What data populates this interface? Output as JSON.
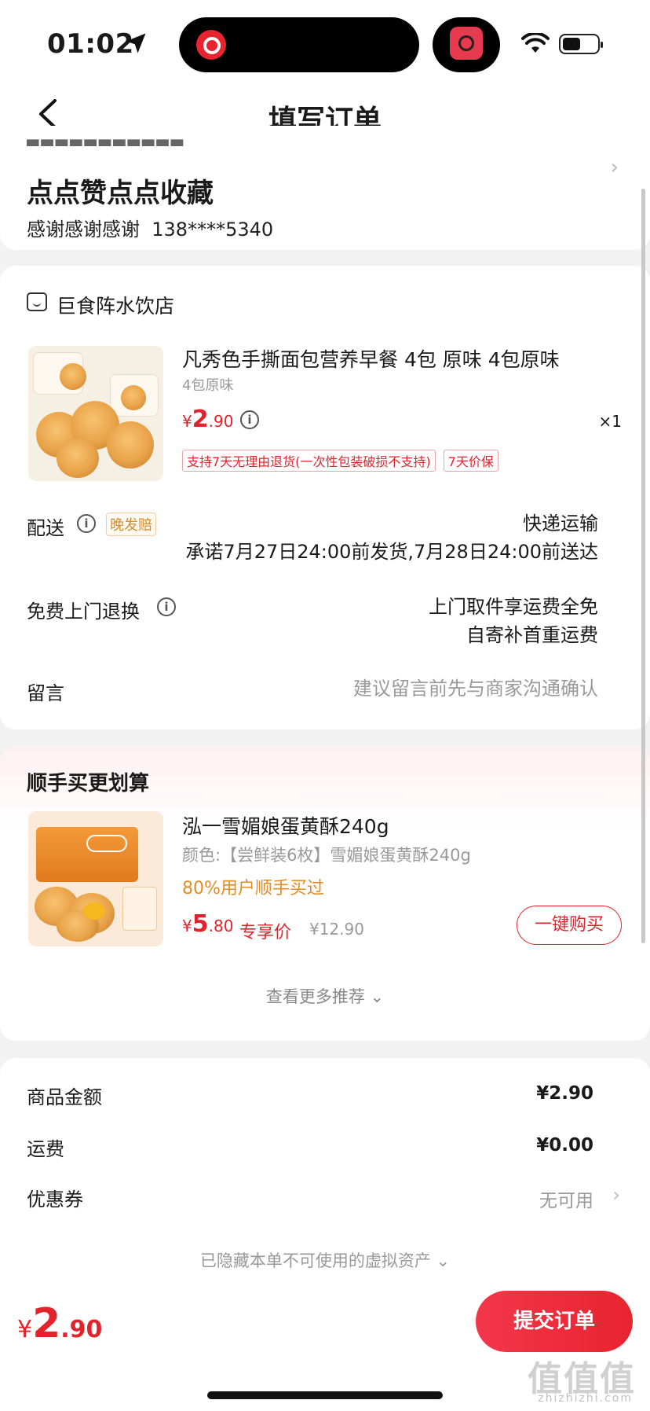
{
  "status_bar": {
    "time": "01:02"
  },
  "nav": {
    "title": "填写订单"
  },
  "address": {
    "name": "点点赞点点收藏",
    "contact_name": "感谢感谢感谢",
    "phone": "138****5340"
  },
  "order": {
    "shop_name": "巨食阵水饮店",
    "product": {
      "title": "凡秀色手撕面包营养早餐 4包 原味 4包原味",
      "spec": "4包原味",
      "price_symbol": "¥",
      "price_int": "2",
      "price_dec": ".90",
      "quantity": "×1",
      "tags": [
        "支持7天无理由退货(一次性包装破损不支持)",
        "7天价保"
      ]
    },
    "delivery": {
      "label": "配送",
      "badge": "晚发赔",
      "method": "快递运输",
      "promise": "承诺7月27日24:00前发货,7月28日24:00前送达"
    },
    "return": {
      "label": "免费上门退换",
      "line1": "上门取件享运费全免",
      "line2": "自寄补首重运费"
    },
    "message": {
      "label": "留言",
      "placeholder": "建议留言前先与商家沟通确认"
    }
  },
  "recommend": {
    "title": "顺手买更划算",
    "item": {
      "title": "泓一雪媚娘蛋黄酥240g",
      "spec": "颜色:【尝鲜装6枚】雪媚娘蛋黄酥240g",
      "hint": "80%用户顺手买过",
      "price_symbol": "¥",
      "price_int": "5",
      "price_dec": ".80",
      "exclusive": "专享价",
      "original_price": "¥12.90",
      "buy_label": "一键购买"
    },
    "more_label": "查看更多推荐 ⌄"
  },
  "summary": {
    "goods_label": "商品金额",
    "goods_value": "¥2.90",
    "shipping_label": "运费",
    "shipping_value": "¥0.00",
    "coupon_label": "优惠券",
    "coupon_value": "无可用",
    "hidden_assets": "已隐藏本单不可使用的虚拟资产 ⌄"
  },
  "bottom": {
    "total_symbol": "¥",
    "total_int": "2",
    "total_dec": ".90",
    "submit_label": "提交订单"
  },
  "watermark": {
    "main": "值值值",
    "sub": "zhizhizhi.com"
  },
  "colors": {
    "accent": "#e2232b",
    "orange": "#e38b24",
    "background": "#f2f2f2"
  }
}
